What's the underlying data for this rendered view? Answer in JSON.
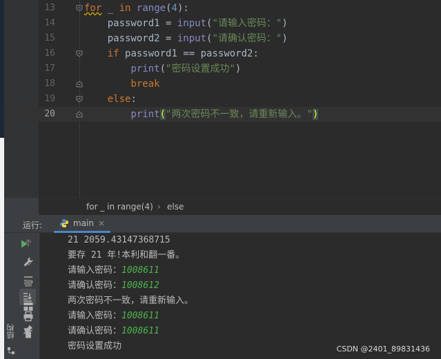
{
  "editor": {
    "lines": [
      {
        "num": "13"
      },
      {
        "num": "14"
      },
      {
        "num": "15"
      },
      {
        "num": "16"
      },
      {
        "num": "17"
      },
      {
        "num": "18"
      },
      {
        "num": "19"
      },
      {
        "num": "20"
      }
    ],
    "tokens": {
      "for": "for",
      "underscore": "_",
      "in": "in",
      "range": "range",
      "range_arg": "4",
      "password1": "password1",
      "password2": "password2",
      "input_fn": "input",
      "str_enter": "\"请输入密码：\"",
      "str_confirm": "\"请确认密码：\"",
      "if": "if",
      "eq": "==",
      "print_fn": "print",
      "str_success": "\"密码设置成功\"",
      "break": "break",
      "else": "else",
      "str_mismatch": "\"两次密码不一致，请重新输入。\""
    }
  },
  "breadcrumb": {
    "item1": "for _ in range(4)",
    "separator": "›",
    "item2": "else"
  },
  "run_panel": {
    "title": "运行:",
    "tab_label": "main",
    "tab_close": "×"
  },
  "console": {
    "lines": [
      {
        "text": "21 2059.43147368715"
      },
      {
        "text": "要存 21 年!本利和翻一番。"
      },
      {
        "prompt": "请输入密码：",
        "input": "1008611"
      },
      {
        "prompt": "请确认密码：",
        "input": "1008612"
      },
      {
        "text": "两次密码不一致，请重新输入。"
      },
      {
        "prompt": "请输入密码：",
        "input": "1008611"
      },
      {
        "prompt": "请确认密码：",
        "input": "1008611"
      },
      {
        "text": "密码设置成功"
      }
    ]
  },
  "side_label": "结构",
  "watermark": "CSDN @2401_89831436",
  "icons": [
    "run-icon",
    "wrench-icon",
    "stop-icon",
    "layout-icon",
    "pin-icon",
    "up-arrow-icon",
    "down-arrow-icon",
    "soft-wrap-icon",
    "scroll-to-end-icon",
    "print-icon",
    "trash-icon",
    "python-icon",
    "structure-icon"
  ],
  "colors": {
    "keyword": "#cc7832",
    "builtin": "#8888c6",
    "string": "#6a8759",
    "number": "#6897bb",
    "input_text": "#4db34d",
    "run_green": "#59a869"
  }
}
